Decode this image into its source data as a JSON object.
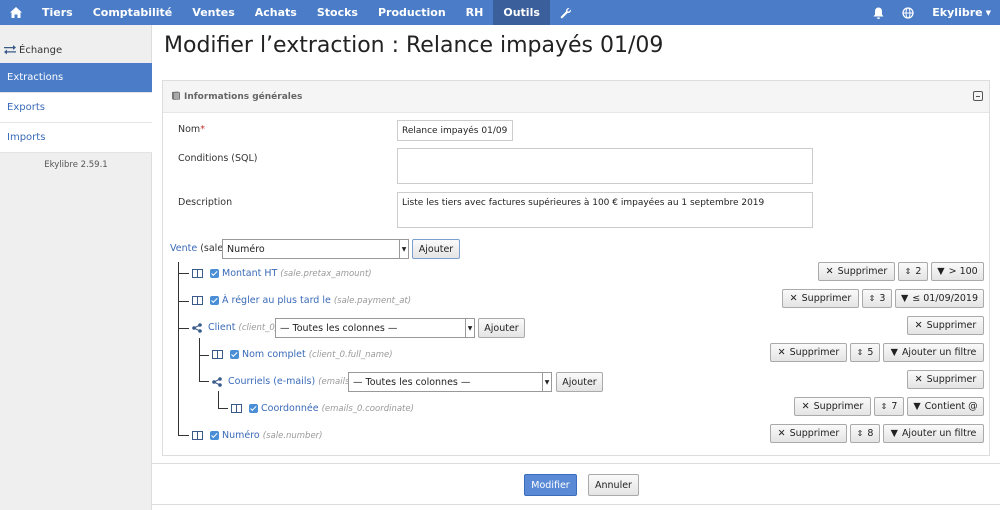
{
  "nav": {
    "items": [
      "Tiers",
      "Comptabilité",
      "Ventes",
      "Achats",
      "Stocks",
      "Production",
      "RH",
      "Outils"
    ],
    "active": "Outils",
    "user": "Ekylibre",
    "accent": "#4a7cc7"
  },
  "sidebar": {
    "header": "Échange",
    "items": [
      {
        "label": "Extractions",
        "active": true
      },
      {
        "label": "Exports",
        "active": false
      },
      {
        "label": "Imports",
        "active": false
      }
    ],
    "version": "Ekylibre 2.59.1"
  },
  "page": {
    "title": "Modifier l’extraction : Relance impayés 01/09"
  },
  "panel": {
    "title": "Informations générales",
    "nom_label": "Nom",
    "nom_required": "*",
    "nom_value": "Relance impayés 01/09",
    "conditions_label": "Conditions (SQL)",
    "conditions_value": "",
    "description_label": "Description",
    "description_value": "Liste les tiers avec factures supérieures à 100 € impayées au 1 septembre 2019"
  },
  "tree": {
    "root_link": "Vente",
    "root_meta": "(sale)",
    "root_select": "Numéro",
    "add_label": "Ajouter",
    "delete_label": "Supprimer",
    "all_columns": "— Toutes les colonnes —",
    "rows": [
      {
        "name": "Montant HT",
        "meta": "(sale.pretax_amount)",
        "order": "2",
        "filter": "> 100"
      },
      {
        "name": "À régler au plus tard le",
        "meta": "(sale.payment_at)",
        "order": "3",
        "filter": "≤ 01/09/2019"
      },
      {
        "name": "Client",
        "meta": "(client_0)"
      },
      {
        "name": "Nom complet",
        "meta": "(client_0.full_name)",
        "order": "5",
        "filter": "Ajouter un filtre"
      },
      {
        "name": "Courriels (e-mails)",
        "meta": "(emails_0)"
      },
      {
        "name": "Coordonnée",
        "meta": "(emails_0.coordinate)",
        "order": "7",
        "filter": "Contient @"
      },
      {
        "name": "Numéro",
        "meta": "(sale.number)",
        "order": "8",
        "filter": "Ajouter un filtre"
      }
    ]
  },
  "footer": {
    "submit": "Modifier",
    "cancel": "Annuler"
  }
}
